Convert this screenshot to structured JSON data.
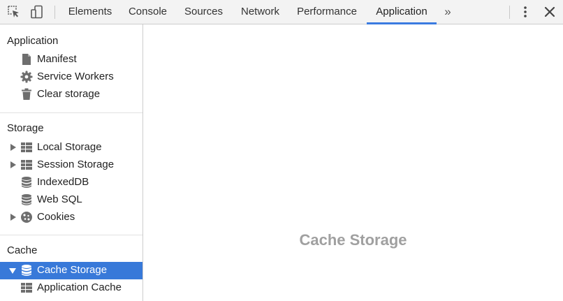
{
  "toolbar": {
    "tabs": [
      {
        "label": "Elements"
      },
      {
        "label": "Console"
      },
      {
        "label": "Sources"
      },
      {
        "label": "Network"
      },
      {
        "label": "Performance"
      },
      {
        "label": "Application",
        "active": true
      }
    ],
    "icons": [
      "inspect-element-icon",
      "device-toolbar-icon",
      "more-tabs-icon",
      "kebab-menu-icon",
      "close-icon"
    ],
    "more_glyph": "»"
  },
  "sidebar": {
    "sections": [
      {
        "title": "Application",
        "items": [
          {
            "label": "Manifest",
            "icon": "file-icon"
          },
          {
            "label": "Service Workers",
            "icon": "gear-icon"
          },
          {
            "label": "Clear storage",
            "icon": "trash-icon"
          }
        ]
      },
      {
        "title": "Storage",
        "items": [
          {
            "label": "Local Storage",
            "icon": "grid-icon",
            "expandable": true
          },
          {
            "label": "Session Storage",
            "icon": "grid-icon",
            "expandable": true
          },
          {
            "label": "IndexedDB",
            "icon": "database-icon"
          },
          {
            "label": "Web SQL",
            "icon": "database-icon"
          },
          {
            "label": "Cookies",
            "icon": "cookie-icon",
            "expandable": true
          }
        ]
      },
      {
        "title": "Cache",
        "items": [
          {
            "label": "Cache Storage",
            "icon": "database-icon",
            "expanded": true,
            "selected": true
          },
          {
            "label": "Application Cache",
            "icon": "grid-icon"
          }
        ]
      }
    ]
  },
  "main": {
    "empty_title": "Cache Storage"
  },
  "colors": {
    "accent": "#3879d9",
    "tab_underline": "#3b7be0",
    "toolbar_bg": "#f3f3f3",
    "icon_gray": "#6e6e6e",
    "empty_text": "#a0a0a0"
  }
}
